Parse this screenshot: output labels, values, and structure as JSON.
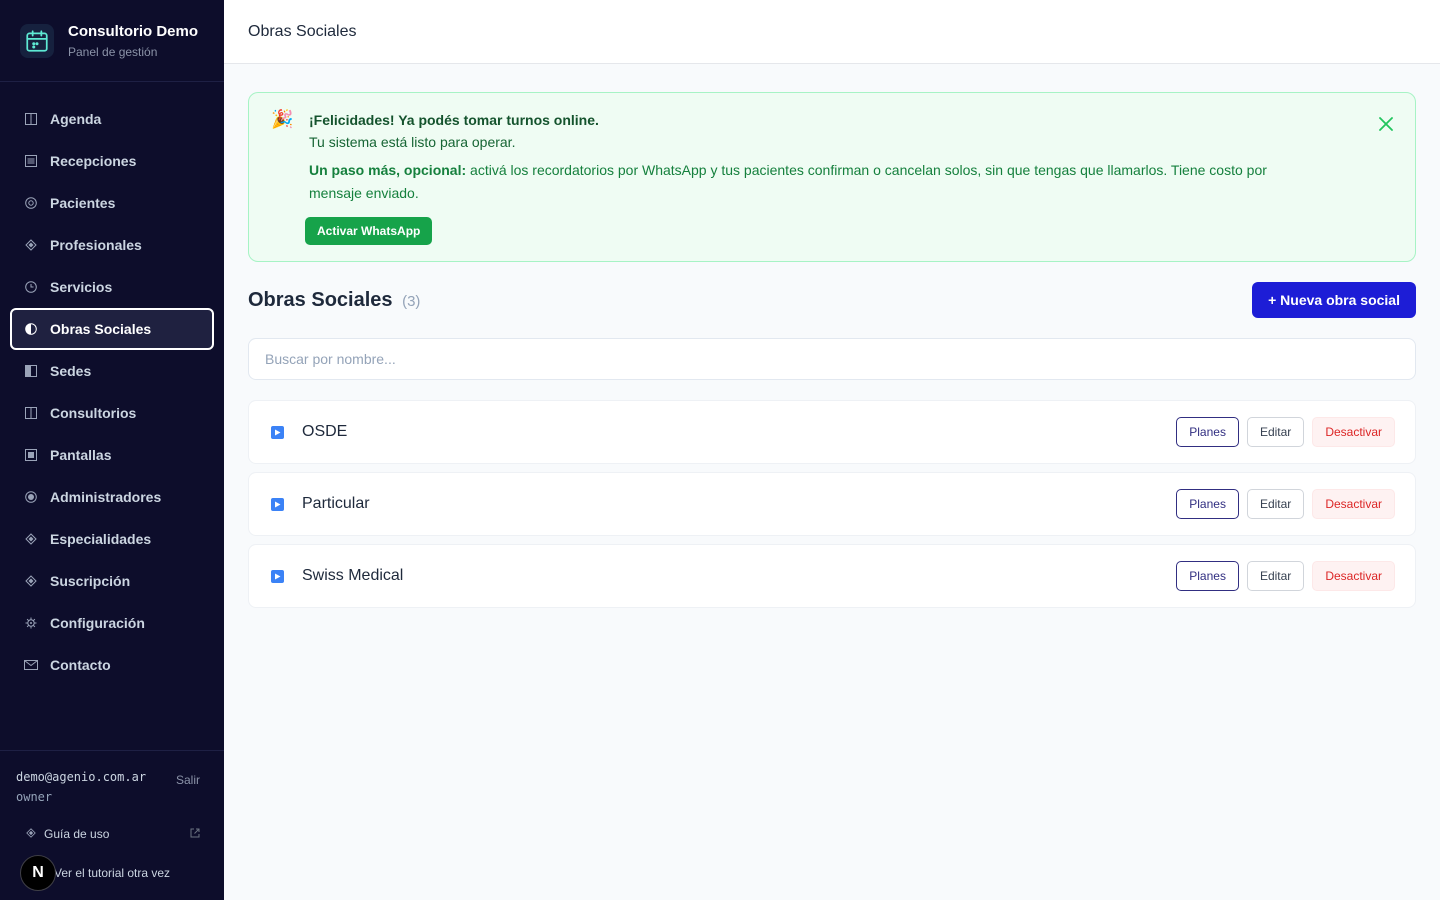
{
  "sidebar": {
    "brand": {
      "title": "Consultorio Demo",
      "subtitle": "Panel de gestión"
    },
    "items": [
      {
        "label": "Agenda",
        "icon": "columns-icon",
        "active": false
      },
      {
        "label": "Recepciones",
        "icon": "list-icon",
        "active": false
      },
      {
        "label": "Pacientes",
        "icon": "target-icon",
        "active": false
      },
      {
        "label": "Profesionales",
        "icon": "diamond-icon",
        "active": false
      },
      {
        "label": "Servicios",
        "icon": "clock-icon",
        "active": false
      },
      {
        "label": "Obras Sociales",
        "icon": "half-circle-icon",
        "active": true
      },
      {
        "label": "Sedes",
        "icon": "half-square-icon",
        "active": false
      },
      {
        "label": "Consultorios",
        "icon": "columns-icon",
        "active": false
      },
      {
        "label": "Pantallas",
        "icon": "square-icon",
        "active": false
      },
      {
        "label": "Administradores",
        "icon": "radio-icon",
        "active": false
      },
      {
        "label": "Especialidades",
        "icon": "diamond-icon",
        "active": false
      },
      {
        "label": "Suscripción",
        "icon": "diamond-icon",
        "active": false
      },
      {
        "label": "Configuración",
        "icon": "gear-icon",
        "active": false
      },
      {
        "label": "Contacto",
        "icon": "mail-icon",
        "active": false
      }
    ],
    "footer": {
      "email": "demo@agenio.com.ar",
      "role": "owner",
      "logout": "Salir",
      "guide": "Guía de uso",
      "tutorial": "Ver el tutorial otra vez",
      "badge": "N"
    }
  },
  "topbar": {
    "title": "Obras Sociales"
  },
  "banner": {
    "emoji": "🎉",
    "title": "¡Felicidades! Ya podés tomar turnos online.",
    "subtitle": "Tu sistema está listo para operar.",
    "text_strong": "Un paso más, opcional:",
    "text": " activá los recordatorios por WhatsApp y tus pacientes confirman o cancelan solos, sin que tengas que llamarlos. Tiene costo por mensaje enviado.",
    "button": "Activar WhatsApp"
  },
  "section": {
    "title": "Obras Sociales",
    "count": "(3)",
    "new_button": "+ Nueva obra social"
  },
  "search": {
    "placeholder": "Buscar por nombre...",
    "value": ""
  },
  "rows": [
    {
      "name": "OSDE",
      "planes": "Planes",
      "editar": "Editar",
      "desactivar": "Desactivar"
    },
    {
      "name": "Particular",
      "planes": "Planes",
      "editar": "Editar",
      "desactivar": "Desactivar"
    },
    {
      "name": "Swiss Medical",
      "planes": "Planes",
      "editar": "Editar",
      "desactivar": "Desactivar"
    }
  ],
  "colors": {
    "sidebar_bg": "#0d0d2b",
    "accent": "#1d1dd6",
    "success": "#16a34a",
    "danger": "#dc2626"
  }
}
